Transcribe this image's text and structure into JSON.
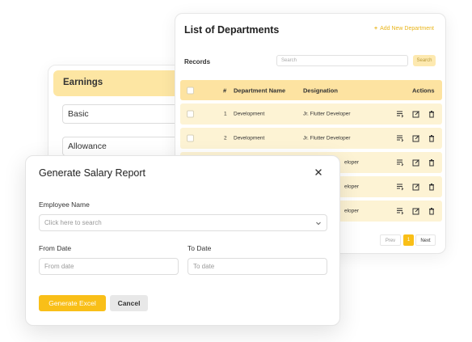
{
  "earnings": {
    "title": "Earnings",
    "fields": [
      "Basic",
      "Allowance"
    ]
  },
  "departments": {
    "title": "List of Departments",
    "add_label": "Add New Department",
    "records_label": "Records",
    "search_placeholder": "Search",
    "search_button": "Search",
    "columns": {
      "checkbox": "",
      "index": "#",
      "name": "Department Name",
      "designation": "Designation",
      "actions": "Actions"
    },
    "rows": [
      {
        "index": "1",
        "name": "Development",
        "designation": "Jr. Flutter Developer"
      },
      {
        "index": "2",
        "name": "Development",
        "designation": "Jr. Flutter Developer"
      },
      {
        "index": "",
        "name": "",
        "designation": "eloper"
      },
      {
        "index": "",
        "name": "",
        "designation": "eloper"
      },
      {
        "index": "",
        "name": "",
        "designation": "eloper"
      }
    ],
    "pagination": {
      "prev": "Prev",
      "current": "1",
      "next": "Next"
    }
  },
  "modal": {
    "title": "Generate Salary Report",
    "employee_label": "Employee Name",
    "employee_placeholder": "Click here to search",
    "from_label": "From Date",
    "from_placeholder": "From date",
    "to_label": "To Date",
    "to_placeholder": "To date",
    "generate_button": "Generate Excel",
    "cancel_button": "Cancel"
  },
  "colors": {
    "accent": "#f9bf18",
    "header_bg": "#fde3a1",
    "row_bg": "#fdf3d4"
  }
}
